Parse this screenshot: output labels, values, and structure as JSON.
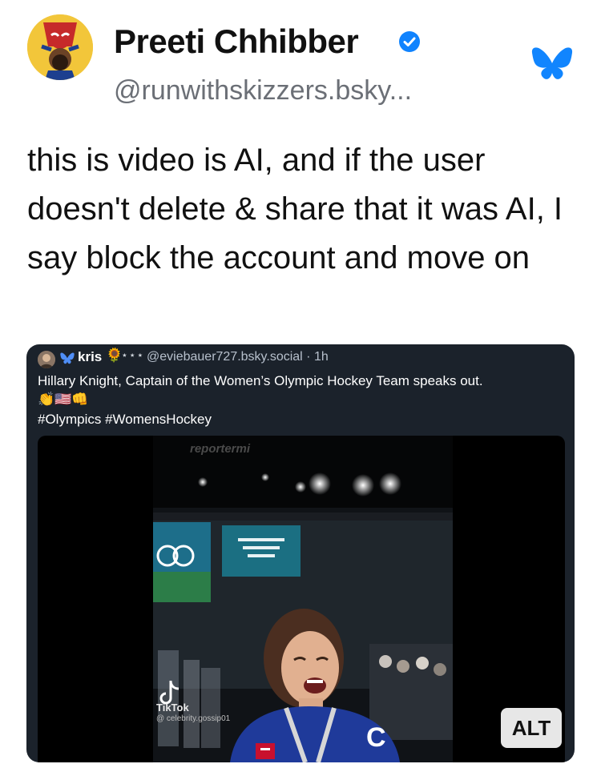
{
  "author": {
    "display_name": "Preeti Chhibber",
    "handle": "@runwithskizzers.bsky...",
    "verified_icon": "verified-check-icon",
    "verified_color": "#1083fe"
  },
  "app_icon": "bluesky-butterfly-icon",
  "brand_color": "#1185fe",
  "post": {
    "text": "this is video is AI, and if the user doesn't delete & share that it was AI, I say block the account and move on"
  },
  "quoted_post": {
    "author_name": "kris",
    "flower_emoji": "🌻",
    "stars": "⋆⋆⋆",
    "handle_time": "@eviebauer727.bsky.social · 1h",
    "text": "Hillary Knight, Captain of the Women’s Olympic Hockey Team speaks out.",
    "emoji_line": "👏🇺🇸👊",
    "hashtags": "#Olympics #WomensHockey",
    "media": {
      "watermark_top": "reportermi",
      "watermark_app": "TikTok",
      "watermark_user": "@ celebrity.gossip01",
      "alt_label": "ALT"
    }
  }
}
